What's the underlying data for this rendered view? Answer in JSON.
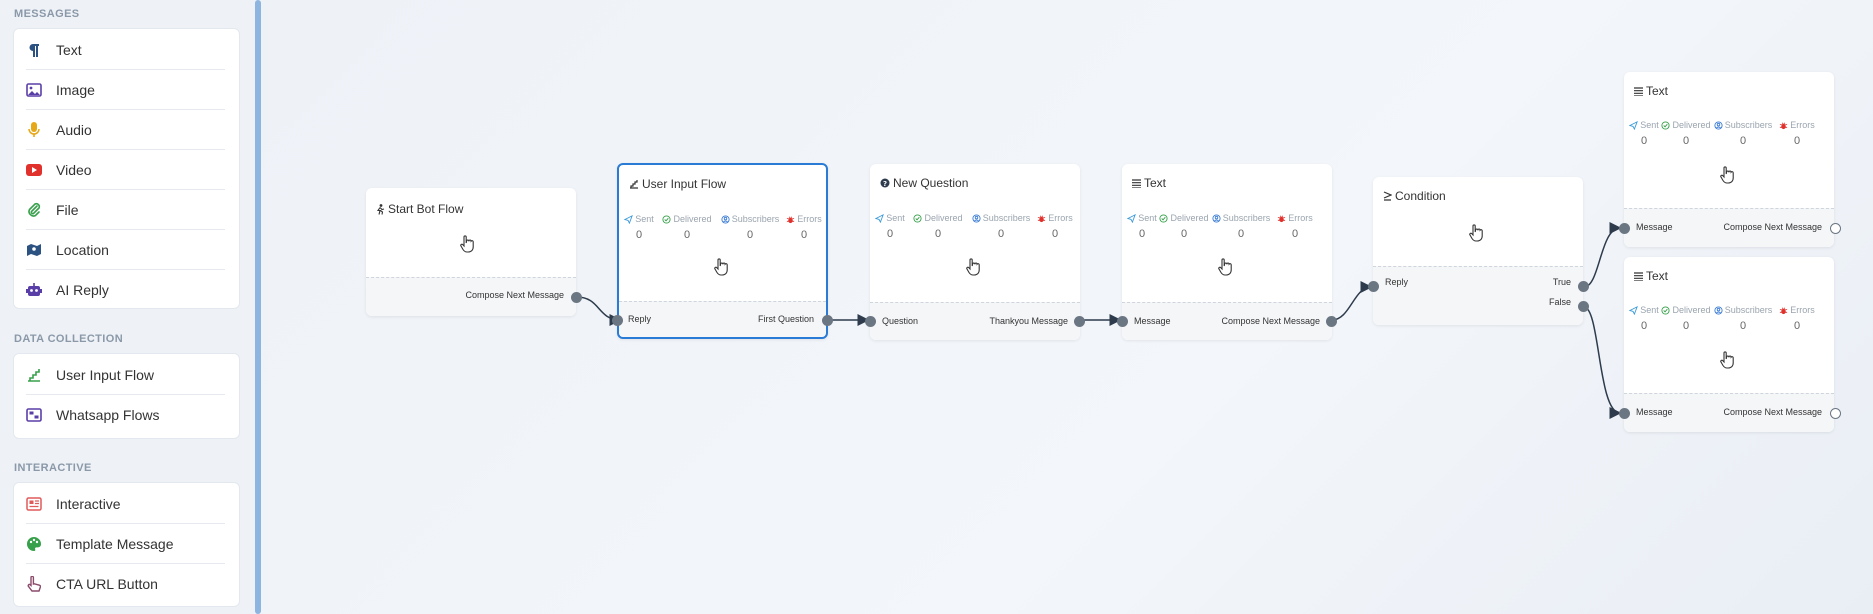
{
  "sidebar": {
    "sections": [
      {
        "title": "MESSAGES",
        "items": [
          {
            "label": "Text",
            "icon": "paragraph-icon",
            "color": "#2c5282"
          },
          {
            "label": "Image",
            "icon": "image-icon",
            "color": "#5a3ea8"
          },
          {
            "label": "Audio",
            "icon": "microphone-icon",
            "color": "#e6a817"
          },
          {
            "label": "Video",
            "icon": "youtube-icon",
            "color": "#e0312c"
          },
          {
            "label": "File",
            "icon": "paperclip-icon",
            "color": "#36a04a"
          },
          {
            "label": "Location",
            "icon": "map-icon",
            "color": "#2c5282"
          },
          {
            "label": "AI Reply",
            "icon": "robot-icon",
            "color": "#5a3ea8"
          }
        ]
      },
      {
        "title": "DATA COLLECTION",
        "items": [
          {
            "label": "User Input Flow",
            "icon": "stairs-icon",
            "color": "#36a04a"
          },
          {
            "label": "Whatsapp Flows",
            "icon": "flow-icon",
            "color": "#5a3ea8"
          }
        ]
      },
      {
        "title": "INTERACTIVE",
        "items": [
          {
            "label": "Interactive",
            "icon": "newspaper-icon",
            "color": "#e05a5a"
          },
          {
            "label": "Template Message",
            "icon": "palette-icon",
            "color": "#36a04a"
          },
          {
            "label": "CTA URL Button",
            "icon": "pointer-hand-icon",
            "color": "#8a4a6a"
          }
        ]
      }
    ]
  },
  "stat_labels": {
    "sent": "Sent",
    "delivered": "Delivered",
    "subscribers": "Subscribers",
    "errors": "Errors"
  },
  "colors": {
    "sent": "#3a9ad9",
    "delivered": "#36a04a",
    "subscribers": "#3a7bd5",
    "errors": "#e0312c",
    "selected": "#2a7bd6"
  },
  "nodes": [
    {
      "title": "Start Bot Flow",
      "icon": "runner-icon",
      "out": "Compose Next Message"
    },
    {
      "title": "User Input Flow",
      "icon": "stairs-icon",
      "stats": [
        "0",
        "0",
        "0",
        "0"
      ],
      "in": "Reply",
      "out": "First Question"
    },
    {
      "title": "New Question",
      "icon": "question-circle-icon",
      "stats": [
        "0",
        "0",
        "0",
        "0"
      ],
      "in": "Question",
      "out": "Thankyou Message"
    },
    {
      "title": "Text",
      "icon": "align-icon",
      "stats": [
        "0",
        "0",
        "0",
        "0"
      ],
      "in": "Message",
      "out": "Compose Next Message"
    },
    {
      "title": "Condition",
      "icon": "greater-equal-icon",
      "in": "Reply",
      "out_true": "True",
      "out_false": "False"
    },
    {
      "title": "Text",
      "icon": "align-icon",
      "stats": [
        "0",
        "0",
        "0",
        "0"
      ],
      "in": "Message",
      "out": "Compose Next Message"
    },
    {
      "title": "Text",
      "icon": "align-icon",
      "stats": [
        "0",
        "0",
        "0",
        "0"
      ],
      "in": "Message",
      "out": "Compose Next Message"
    }
  ]
}
